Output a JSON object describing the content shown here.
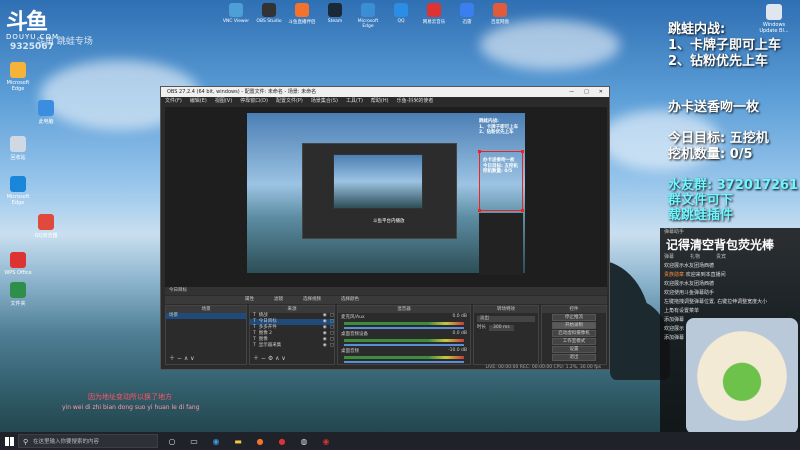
{
  "brand": {
    "logo_text": "斗鱼",
    "logo_sub": "DOUYU.COM",
    "room_label": "斗鱼 跳蛙专场",
    "room_id": "9325067"
  },
  "desktop_icons": [
    {
      "label": "Microsoft Edge",
      "color": "#f6b33a"
    },
    {
      "label": "此电脑",
      "color": "#3c8de0"
    },
    {
      "label": "回收站",
      "color": "#cfd8e3"
    },
    {
      "label": "Microsoft Edge",
      "color": "#1a86d9"
    },
    {
      "label": "QQ浏览器",
      "color": "#e04a3c"
    },
    {
      "label": "WPS Office",
      "color": "#d33"
    },
    {
      "label": "文件夹",
      "color": "#2e8f4a"
    }
  ],
  "top_icons": [
    {
      "label": "VNC Viewer",
      "color": "#4e9fd6"
    },
    {
      "label": "OBS Studio",
      "color": "#333"
    },
    {
      "label": "斗鱼直播伴侣",
      "color": "#f4722b"
    },
    {
      "label": "Steam",
      "color": "#1b2838"
    },
    {
      "label": "Microsoft Edge",
      "color": "#3b8ed4"
    },
    {
      "label": "QQ",
      "color": "#2b8ee6"
    },
    {
      "label": "网易云音乐",
      "color": "#d33"
    },
    {
      "label": "迅雷",
      "color": "#3a7ef0"
    },
    {
      "label": "百度网盘",
      "color": "#e05b3c"
    }
  ],
  "windows_update": "Windows Update Bl...",
  "overlay": {
    "line1": "跳蛙内战:",
    "line2": "1、卡牌子即可上车",
    "line3": "2、钻粉优先上车",
    "line4": "办卡送香吻一枚",
    "line5": "今日目标:  五挖机",
    "line6": "挖机数量: 0/5",
    "line7": "水友群: 372017261",
    "line8": "群文件可下",
    "line9": "载跳蛙插件"
  },
  "obs": {
    "title": "OBS 27.2.4 (64 bit, windows) - 配置文件: 未命名 - 场景: 未命名",
    "menu": [
      "文件(F)",
      "编辑(E)",
      "视图(V)",
      "停靠窗口(D)",
      "配置文件(P)",
      "场景集合(S)",
      "工具(T)",
      "帮助(H)",
      "乐鱼-抖米的使者"
    ],
    "preview_subtitle": "斗鱼平台内播放",
    "source_bar": [
      "今日目标"
    ],
    "toolbar": [
      "属性",
      "滤镜",
      "选择视频",
      "选择颜色"
    ],
    "scenes_header": "场景",
    "scenes": [
      "场景"
    ],
    "sources_header": "来源",
    "sources": [
      "挑战",
      "今日目标",
      "多多开件",
      "图像 2",
      "图像",
      "显示器采集"
    ],
    "mixer_header": "混音器",
    "mixer": [
      {
        "name": "麦克风/Aux",
        "db": "0.0 dB"
      },
      {
        "name": "桌面音频设备",
        "db": "0.0 dB"
      },
      {
        "name": "桌面音频",
        "db": "-10.0 dB"
      }
    ],
    "transition_header": "转场特效",
    "transition": {
      "type": "淡出",
      "duration_label": "时长",
      "duration": "300 ms"
    },
    "controls_header": "控件",
    "controls": [
      "停止推流",
      "开始录制",
      "启动虚拟摄像机",
      "工作室模式",
      "设置",
      "退出"
    ],
    "status": "LIVE: 00:00:00   REC: 00:00:00   CPU: 1.2%, 30.00 fps"
  },
  "chat": {
    "header": "弹幕助手",
    "big": "记得清空背包荧光棒",
    "tabs": [
      "弹幕",
      "礼物",
      "贵宾"
    ],
    "messages": [
      {
        "name": "",
        "text": "欢迎展示水友团场西德"
      },
      {
        "name": "贵族勋章",
        "text": "欢迎来到本直播间"
      },
      {
        "name": "",
        "text": "欢迎展示水友团场西德"
      },
      {
        "name": "",
        "text": "欢迎使用斗鱼弹幕助手"
      },
      {
        "name": "",
        "text": "左键拖拽调整弹幕位置, 右键拉伸调整宽度大小"
      },
      {
        "name": "",
        "text": "上角有设置菜单"
      },
      {
        "name": "",
        "text": "添加弹幕"
      },
      {
        "name": "",
        "text": "欢迎展示"
      },
      {
        "name": "",
        "text": "添加弹幕"
      }
    ]
  },
  "captions": {
    "line1": "因为地址变动所以换了地方",
    "line2": "yin wei di zhi bian dong suo yi huan le di fang"
  },
  "taskbar": {
    "search_placeholder": "在这里输入你要搜索的内容"
  }
}
